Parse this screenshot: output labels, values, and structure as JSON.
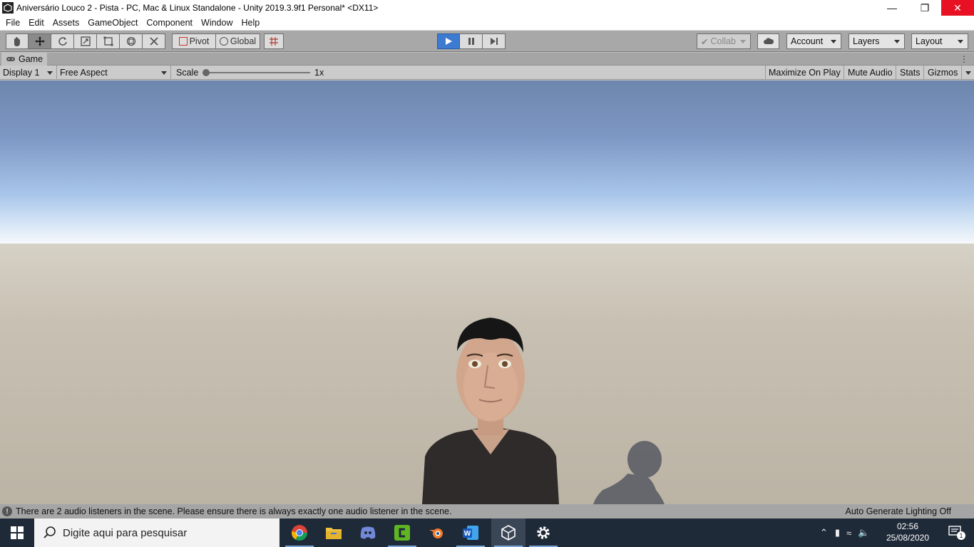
{
  "window": {
    "title": "Aniversário Louco 2 - Pista - PC, Mac & Linux Standalone - Unity 2019.3.9f1 Personal* <DX11>"
  },
  "menu": [
    "File",
    "Edit",
    "Assets",
    "GameObject",
    "Component",
    "Window",
    "Help"
  ],
  "toolbar": {
    "pivot_label": "Pivot",
    "global_label": "Global",
    "collab_label": "Collab",
    "account_label": "Account",
    "layers_label": "Layers",
    "layout_label": "Layout"
  },
  "game_tab": {
    "label": "Game"
  },
  "game_controls": {
    "display": "Display 1",
    "aspect": "Free Aspect",
    "scale_label": "Scale",
    "scale_value": "1x",
    "maximize": "Maximize On Play",
    "mute": "Mute Audio",
    "stats": "Stats",
    "gizmos": "Gizmos"
  },
  "status": {
    "message": "There are 2 audio listeners in the scene. Please ensure there is always exactly one audio listener in the scene.",
    "lighting": "Auto Generate Lighting Off"
  },
  "taskbar": {
    "search_placeholder": "Digite aqui para pesquisar",
    "apps": [
      "chrome-icon",
      "file-explorer-icon",
      "discord-icon",
      "camtasia-icon",
      "blender-icon",
      "word-icon",
      "unity-icon",
      "settings-icon"
    ],
    "time": "02:56",
    "date": "25/08/2020",
    "notification_count": "1"
  },
  "colors": {
    "play_active": "#3d7bd0",
    "close_button": "#e81123",
    "taskbar": "#1f2a38"
  }
}
